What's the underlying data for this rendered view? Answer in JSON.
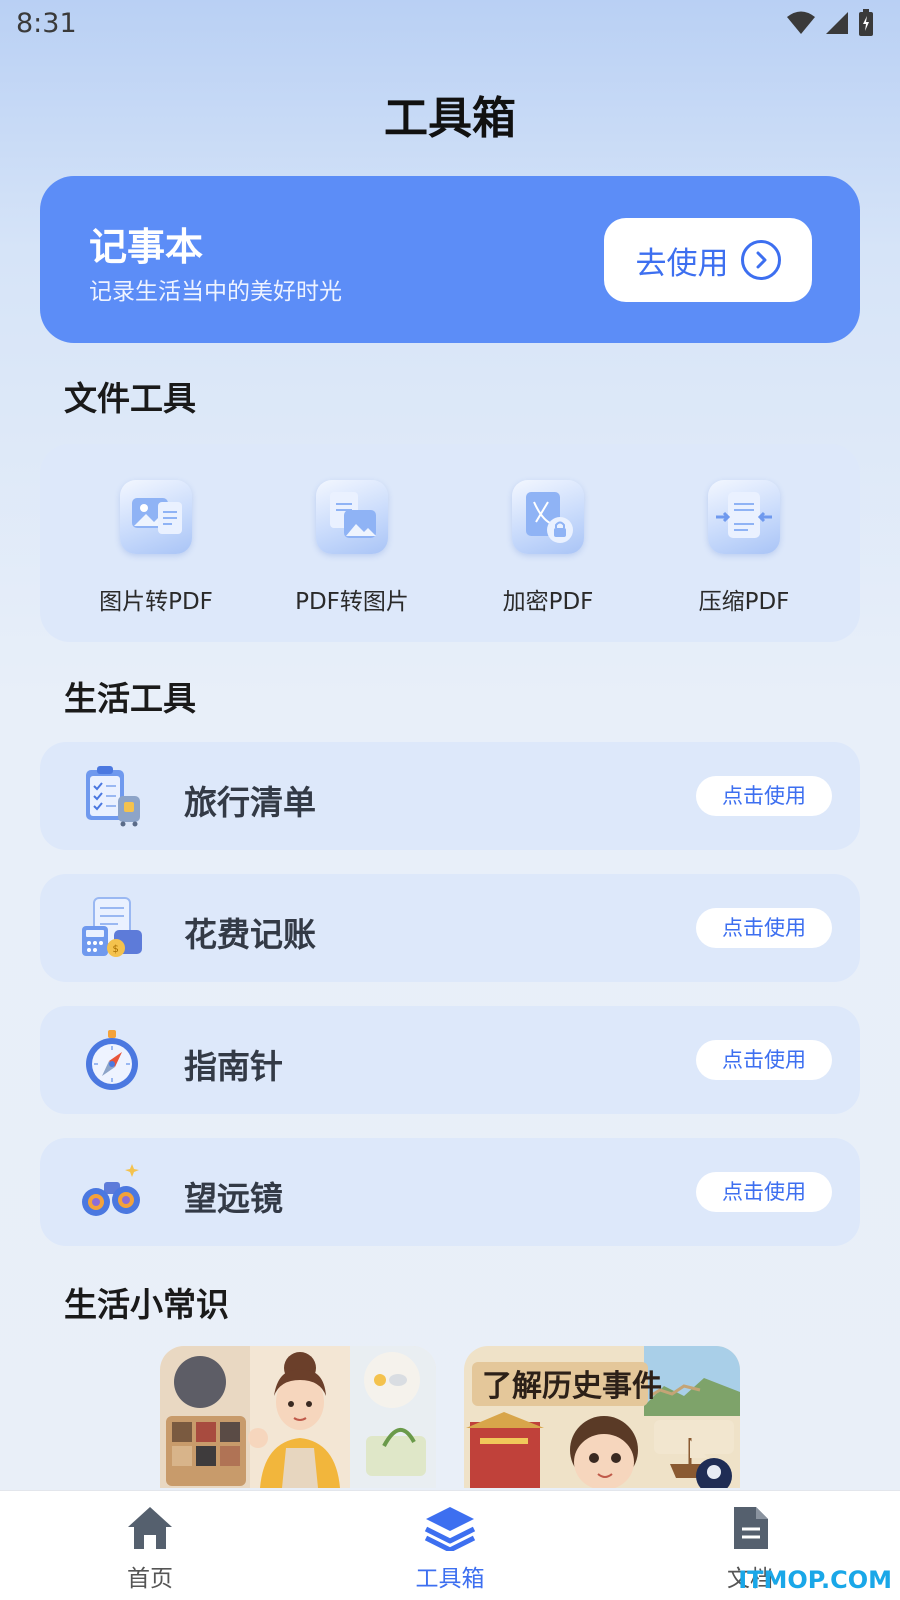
{
  "status_bar": {
    "time": "8:31"
  },
  "header": {
    "title": "工具箱"
  },
  "notebook": {
    "title": "记事本",
    "subtitle": "记录生活当中的美好时光",
    "button_label": "去使用"
  },
  "file_tools": {
    "section_title": "文件工具",
    "items": [
      {
        "label": "图片转PDF",
        "icon": "image-to-pdf-icon"
      },
      {
        "label": "PDF转图片",
        "icon": "pdf-to-image-icon"
      },
      {
        "label": "加密PDF",
        "icon": "encrypt-pdf-icon"
      },
      {
        "label": "压缩PDF",
        "icon": "compress-pdf-icon"
      }
    ]
  },
  "life_tools": {
    "section_title": "生活工具",
    "items": [
      {
        "label": "旅行清单",
        "button": "点击使用",
        "icon": "travel-checklist-icon"
      },
      {
        "label": "花费记账",
        "button": "点击使用",
        "icon": "expense-ledger-icon"
      },
      {
        "label": "指南针",
        "button": "点击使用",
        "icon": "compass-icon"
      },
      {
        "label": "望远镜",
        "button": "点击使用",
        "icon": "binoculars-icon"
      }
    ]
  },
  "tips": {
    "section_title": "生活小常识",
    "cards": [
      {
        "title": "",
        "image": "housekeeping-tips-image"
      },
      {
        "title": "了解历史事件",
        "image": "history-events-image"
      }
    ]
  },
  "tab_bar": {
    "tabs": [
      {
        "label": "首页",
        "icon": "home-icon",
        "active": false
      },
      {
        "label": "工具箱",
        "icon": "layers-icon",
        "active": true
      },
      {
        "label": "文档",
        "icon": "document-icon",
        "active": false
      }
    ]
  },
  "watermark": "ITMOP.COM",
  "colors": {
    "accent": "#5c8df7",
    "active_tab": "#3d6ff0",
    "card_bg": "#dde8fa"
  }
}
